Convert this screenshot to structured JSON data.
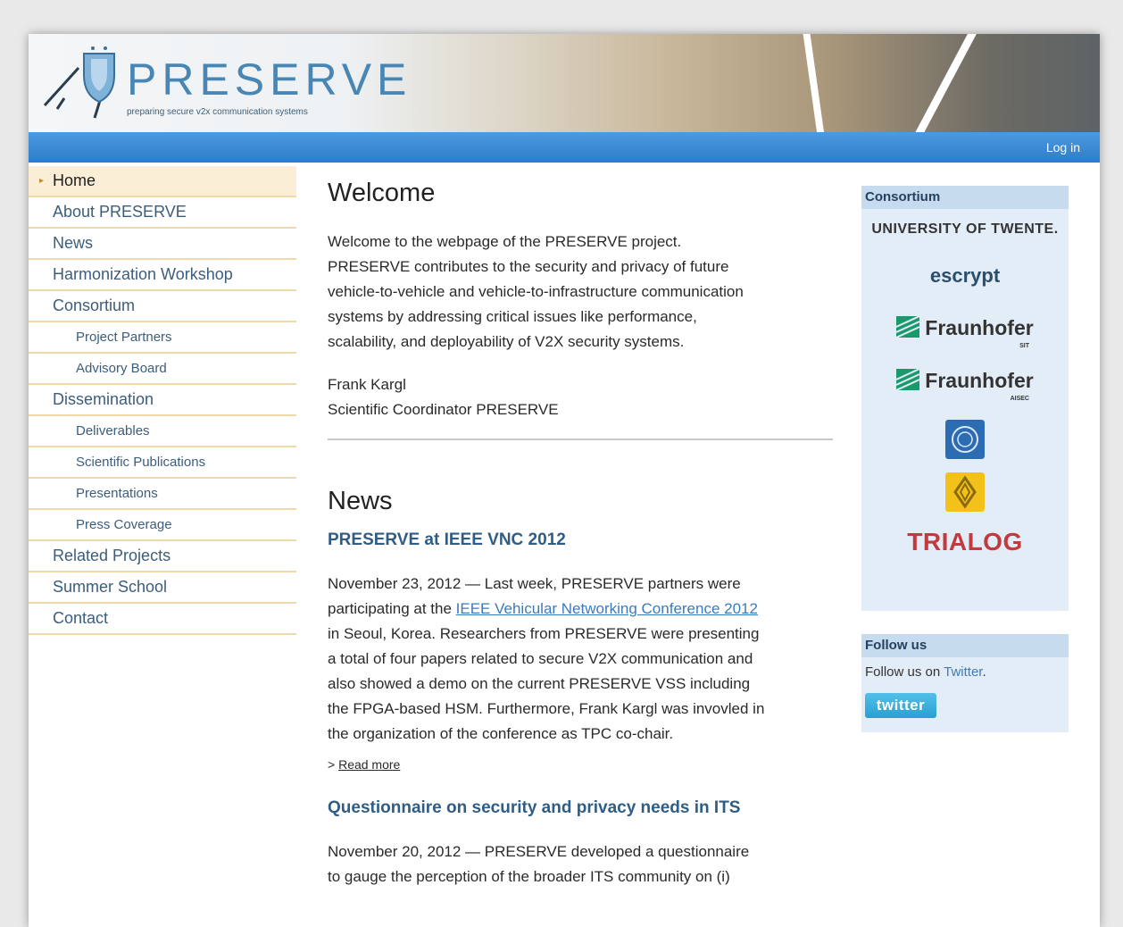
{
  "header": {
    "logo_text": "PRESERVE",
    "tagline": "preparing secure v2x communication systems",
    "login_label": "Log in"
  },
  "nav": {
    "items": [
      {
        "label": "Home",
        "level": 1,
        "active": true
      },
      {
        "label": "About PRESERVE",
        "level": 1
      },
      {
        "label": "News",
        "level": 1
      },
      {
        "label": "Harmonization Workshop",
        "level": 1
      },
      {
        "label": "Consortium",
        "level": 1
      },
      {
        "label": "Project Partners",
        "level": 2
      },
      {
        "label": "Advisory Board",
        "level": 2
      },
      {
        "label": "Dissemination",
        "level": 1
      },
      {
        "label": "Deliverables",
        "level": 2
      },
      {
        "label": "Scientific Publications",
        "level": 2
      },
      {
        "label": "Presentations",
        "level": 2
      },
      {
        "label": "Press Coverage",
        "level": 2
      },
      {
        "label": "Related Projects",
        "level": 1
      },
      {
        "label": "Summer School",
        "level": 1
      },
      {
        "label": "Contact",
        "level": 1
      }
    ]
  },
  "welcome": {
    "heading": "Welcome",
    "body_lines": [
      "Welcome to the webpage of the PRESERVE project.",
      "PRESERVE contributes to the security and privacy of future",
      "vehicle-to-vehicle and vehicle-to-infrastructure communication",
      "systems by addressing critical issues like performance,",
      "scalability, and deployability of V2X security systems."
    ],
    "signature_name": "Frank Kargl",
    "signature_role": "Scientific Coordinator PRESERVE"
  },
  "news": {
    "heading": "News",
    "items": [
      {
        "title": "PRESERVE at IEEE VNC 2012",
        "lines": [
          {
            "text": "November 23, 2012 — Last week, PRESERVE partners were"
          },
          {
            "before": "participating at the ",
            "link": "IEEE Vehicular Networking Conference 2012"
          },
          {
            "text": "in Seoul, Korea. Researchers from PRESERVE were presenting"
          },
          {
            "text": "a total of four papers related to secure V2X communication and"
          },
          {
            "text": "also showed a demo on the current PRESERVE VSS including"
          },
          {
            "text": "the FPGA-based HSM. Furthermore, Frank Kargl was invovled in"
          },
          {
            "text": "the organization of the conference as TPC co-chair."
          }
        ],
        "read_more_prefix": "> ",
        "read_more": "Read more"
      },
      {
        "title": "Questionnaire on security and privacy needs in ITS",
        "lines": [
          {
            "text": "November 20, 2012 — PRESERVE developed a questionnaire"
          },
          {
            "text": "to gauge the perception of the broader ITS community on (i)"
          }
        ]
      }
    ]
  },
  "sidebar": {
    "consortium_title": "Consortium",
    "partners": {
      "twente": "UNIVERSITY OF TWENTE.",
      "escrypt_a": "es",
      "escrypt_b": "crypt",
      "fraunhofer_1": "Fraunhofer",
      "fraunhofer_1_sub": "SIT",
      "fraunhofer_2": "Fraunhofer",
      "fraunhofer_2_sub": "AISEC",
      "trialog": "TRIALOG"
    },
    "follow_title": "Follow us",
    "follow_prefix": "Follow us on ",
    "follow_link": "Twitter",
    "follow_suffix": ".",
    "twitter_button": "twitter"
  },
  "colors": {
    "topbar": "#2e7cc8",
    "nav_text": "#3c5d7b",
    "nav_divider": "#f1d8a8",
    "news_title": "#2f5d86",
    "sidebar_bg": "#e3edf8"
  }
}
